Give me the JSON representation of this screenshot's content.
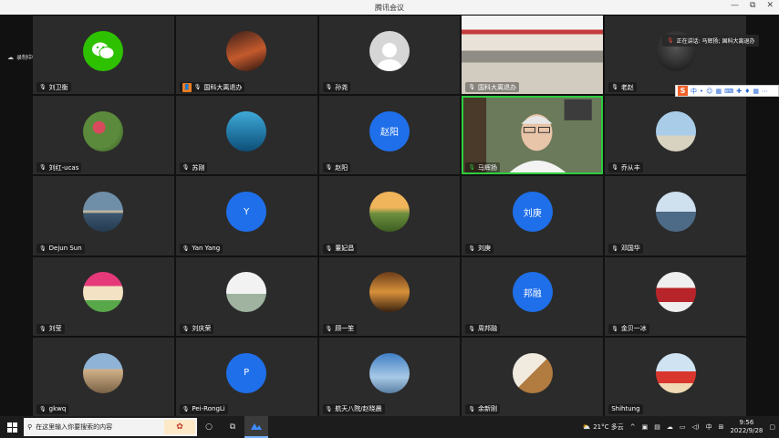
{
  "window": {
    "title": "腾讯会议",
    "min": "—",
    "max": "⧉",
    "close": "✕"
  },
  "recording": {
    "label": "录制中"
  },
  "speaking": {
    "label": "正在讲话: 马辉扬; 国科大离退办"
  },
  "ime": {
    "logo": "S",
    "items": [
      "中",
      "•",
      "☺",
      "▦",
      "⌨",
      "✚",
      "♦",
      "▦",
      "⋯"
    ]
  },
  "participants": [
    {
      "name": "刘卫衡",
      "avatar": "wechat",
      "muted": false
    },
    {
      "name": "国科大离退办",
      "avatar": "sunset",
      "host": true
    },
    {
      "name": "孙尧",
      "avatar": "grey-person",
      "muted": false
    },
    {
      "name": "国科大离退办",
      "avatar": "conference-video",
      "muted": false
    },
    {
      "name": "老赵",
      "avatar": "dark-person",
      "muted": false
    },
    {
      "name": "刘红-ucas",
      "avatar": "flowers",
      "muted": false
    },
    {
      "name": "苏刚",
      "avatar": "underwater",
      "muted": false
    },
    {
      "name": "赵阳",
      "avatar": "initials",
      "initials": "赵阳",
      "color": "#1f6fea"
    },
    {
      "name": "马辉扬",
      "avatar": "speaker-video",
      "active": true
    },
    {
      "name": "乔从丰",
      "avatar": "beach",
      "muted": false
    },
    {
      "name": "Dejun Sun",
      "avatar": "lake",
      "muted": false
    },
    {
      "name": "Yan Yang",
      "avatar": "initials",
      "initials": "Y",
      "color": "#1f6fea"
    },
    {
      "name": "董妃昌",
      "avatar": "field-sunset",
      "muted": false
    },
    {
      "name": "刘庚",
      "avatar": "initials",
      "initials": "刘庚",
      "color": "#1f6fea"
    },
    {
      "name": "邓国华",
      "avatar": "runner",
      "muted": false
    },
    {
      "name": "刘莹",
      "avatar": "pink-banner",
      "muted": false
    },
    {
      "name": "刘庆荣",
      "avatar": "white-building",
      "muted": false
    },
    {
      "name": "顾一笙",
      "avatar": "golden-temple",
      "muted": false
    },
    {
      "name": "周邦融",
      "avatar": "initials",
      "initials": "邦融",
      "color": "#1f6fea"
    },
    {
      "name": "金贝一冰",
      "avatar": "red-room",
      "muted": false
    },
    {
      "name": "gkwq",
      "avatar": "buildings",
      "muted": false
    },
    {
      "name": "Pei-RongLi",
      "avatar": "initials",
      "initials": "P",
      "color": "#1f6fea"
    },
    {
      "name": "航天八院/赵晓晨",
      "avatar": "blue-sky",
      "muted": false
    },
    {
      "name": "余新刚",
      "avatar": "guitar",
      "muted": false
    },
    {
      "name": "Shihtung",
      "avatar": "red-flag",
      "noMic": true
    }
  ],
  "taskbar": {
    "search_placeholder": "在这里输入你要搜索的内容",
    "weather": "21°C 多云",
    "ime_lang": "中",
    "time": "9:56",
    "date": "2022/9/28",
    "colors": {
      "accent": "#1f6fea",
      "host": "#f07d1e"
    }
  }
}
